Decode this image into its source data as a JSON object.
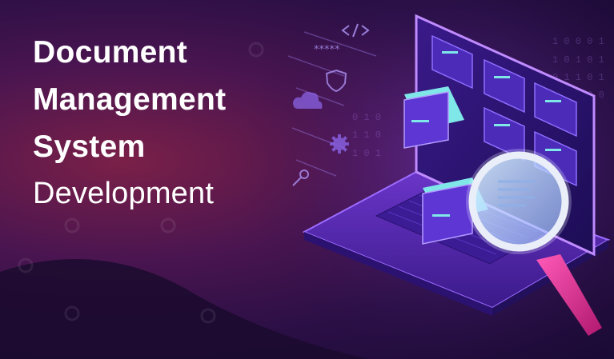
{
  "banner": {
    "title_lines": [
      "Document",
      "Management",
      "System"
    ],
    "subtitle": "Development",
    "colors": {
      "background_dark": "#1a0a35",
      "background_warm": "#7a2048",
      "laptop_purple": "#5b2bb0",
      "screen_glow": "#c08bff",
      "folder_teal": "#7fe7e8",
      "magnifier_pink": "#e0338f"
    },
    "decorative_icons": [
      "code-icon",
      "password-icon",
      "shield-icon",
      "cloud-icon",
      "gear-icon",
      "key-icon",
      "binary-digits",
      "folder-drawer-icon",
      "magnifying-glass-icon",
      "laptop-illustration",
      "brand-logo-watermark"
    ]
  }
}
